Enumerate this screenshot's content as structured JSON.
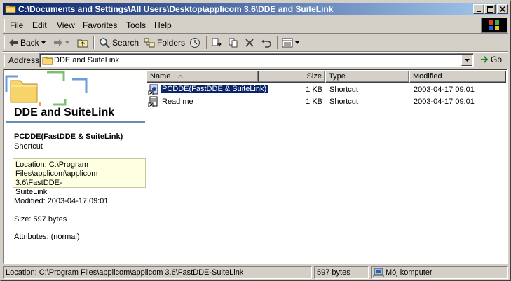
{
  "window": {
    "title": "C:\\Documents and Settings\\All Users\\Desktop\\applicom 3.6\\DDE and SuiteLink"
  },
  "menu": [
    "File",
    "Edit",
    "View",
    "Favorites",
    "Tools",
    "Help"
  ],
  "toolbar": {
    "back_label": "Back",
    "search_label": "Search",
    "folders_label": "Folders"
  },
  "address": {
    "label": "Address",
    "value": "DDE and SuiteLink",
    "go_label": "Go"
  },
  "left_pane": {
    "folder_title": "DDE and SuiteLink",
    "selected_name": "PCDDE(FastDDE & SuiteLink)",
    "selected_type": "Shortcut",
    "location_line1": "Location: C:\\Program",
    "location_line2": "Files\\applicom\\applicom 3.6\\FastDDE-",
    "location_line3": "SuiteLink",
    "modified": "Modified: 2003-04-17 09:01",
    "size": "Size: 597 bytes",
    "attributes": "Attributes: (normal)"
  },
  "columns": {
    "name": "Name",
    "size": "Size",
    "type": "Type",
    "modified": "Modified"
  },
  "files": [
    {
      "name": "PCDDE(FastDDE & SuiteLink)",
      "size": "1 KB",
      "type": "Shortcut",
      "modified": "2003-04-17 09:01",
      "selected": true,
      "icon": "shortcut-icon"
    },
    {
      "name": "Read me",
      "size": "1 KB",
      "type": "Shortcut",
      "modified": "2003-04-17 09:01",
      "selected": false,
      "icon": "document-shortcut-icon"
    }
  ],
  "status": {
    "location": "Location: C:\\Program Files\\applicom\\applicom 3.6\\FastDDE-SuiteLink",
    "size": "597 bytes",
    "zone": "Mój komputer"
  },
  "colors": {
    "title_start": "#0a246a",
    "title_end": "#a6caf0",
    "selection": "#0a246a",
    "info_bg": "#ffffe1"
  }
}
